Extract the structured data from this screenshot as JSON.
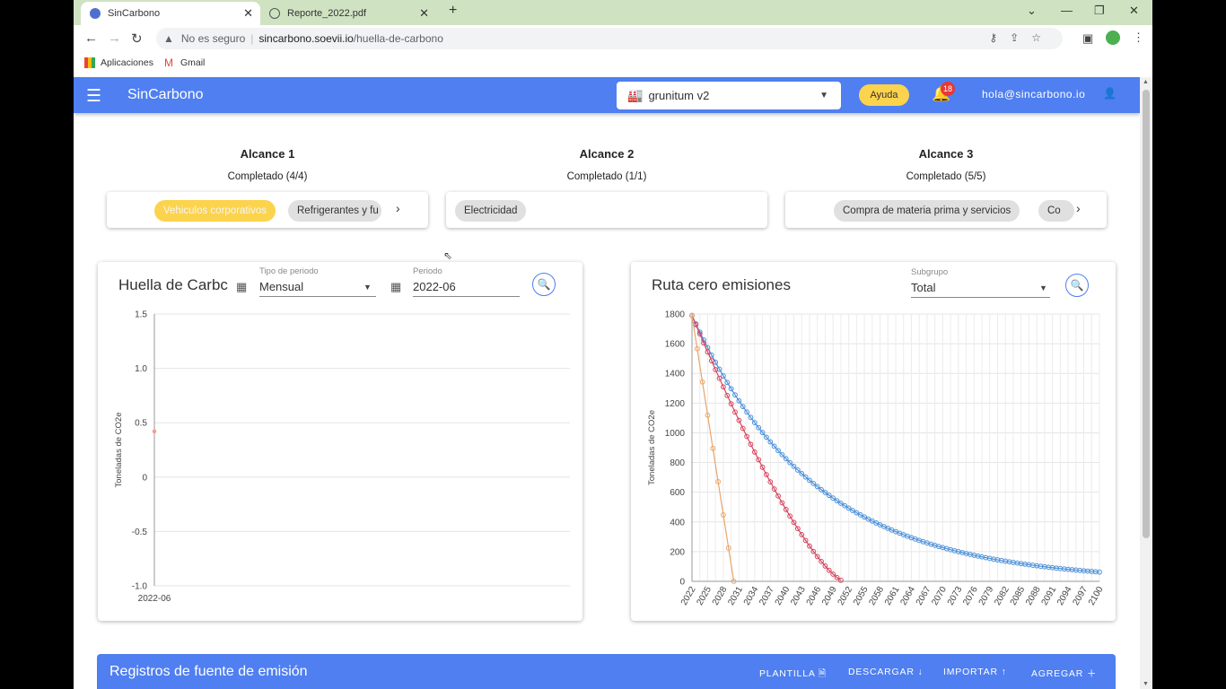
{
  "browser": {
    "tabs": [
      {
        "title": "SinCarbono"
      },
      {
        "title": "Reporte_2022.pdf"
      }
    ],
    "new_tab": "+",
    "security_label": "No es seguro",
    "url_host": "sincarbono.soevii.io",
    "url_path": "/huella-de-carbono",
    "bookmarks": [
      {
        "label": "Aplicaciones"
      },
      {
        "label": "Gmail"
      }
    ]
  },
  "app": {
    "brand": "SinCarbono",
    "company": "grunitum v2",
    "help": "Ayuda",
    "notifications": "18",
    "user": "hola@sincarbono.io"
  },
  "scopes": [
    {
      "title": "Alcance 1",
      "status": "Completado (4/4)",
      "chips": [
        "Vehiculos corporativos",
        "Refrigerantes y fu"
      ]
    },
    {
      "title": "Alcance 2",
      "status": "Completado (1/1)",
      "chips": [
        "Electricidad"
      ]
    },
    {
      "title": "Alcance 3",
      "status": "Completado (5/5)",
      "chips": [
        "Compra de materia prima y servicios",
        "Co"
      ]
    }
  ],
  "footprint": {
    "title": "Huella de Carbc",
    "period_type_label": "Tipo de periodo",
    "period_type_value": "Mensual",
    "period_label": "Periodo",
    "period_value": "2022-06"
  },
  "route": {
    "title": "Ruta cero emisiones",
    "subgroup_label": "Subgrupo",
    "subgroup_value": "Total"
  },
  "chart_data": [
    {
      "type": "scatter",
      "ylabel": "Toneladas de CO2e",
      "categories": [
        "2022-06"
      ],
      "series": [
        {
          "values": [
            0.42
          ],
          "color": "#f0a08c"
        }
      ],
      "ylim": [
        -1.0,
        1.5
      ],
      "yticks": [
        "1.5",
        "1.0",
        "0.5",
        "0",
        "-0.5",
        "-1.0"
      ],
      "grid": true
    },
    {
      "type": "line",
      "ylabel": "Toneladas de CO2e",
      "xlim": [
        2022,
        2100
      ],
      "ylim": [
        0,
        1800
      ],
      "yticks": [
        "1800",
        "1600",
        "1400",
        "1200",
        "1000",
        "800",
        "600",
        "400",
        "200",
        "0"
      ],
      "xticks": [
        "2022",
        "2025",
        "2028",
        "2031",
        "2034",
        "2037",
        "2040",
        "2043",
        "2046",
        "2049",
        "2052",
        "2055",
        "2058",
        "2061",
        "2064",
        "2067",
        "2070",
        "2073",
        "2076",
        "2079",
        "2082",
        "2085",
        "2088",
        "2091",
        "2094",
        "2097",
        "2100"
      ],
      "grid": true,
      "series": [
        {
          "color": "#4a90d9",
          "model": "exp",
          "start": 2022,
          "end": 2100,
          "y0": 1790,
          "rate": 0.043
        },
        {
          "color": "#d9455f",
          "model": "quadratic",
          "start": 2022,
          "end": 2051,
          "y0": 1790
        },
        {
          "color": "#e8a56a",
          "model": "linear",
          "start": 2022,
          "end": 2030,
          "y0": 1790
        }
      ]
    }
  ],
  "records": {
    "title": "Registros de fuente de emisión",
    "actions": [
      "PLANTILLA",
      "DESCARGAR",
      "IMPORTAR",
      "AGREGAR"
    ]
  }
}
